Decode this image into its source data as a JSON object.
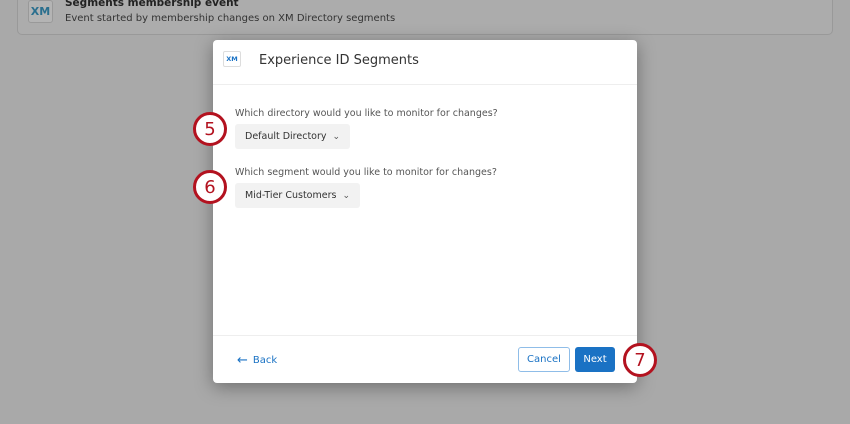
{
  "background": {
    "logo": "XM",
    "title": "Segments membership event",
    "subtitle": "Event started by membership changes on XM Directory segments"
  },
  "modal": {
    "logo": "XM",
    "title": "Experience ID Segments",
    "directory_question": "Which directory would you like to monitor for changes?",
    "directory_value": "Default Directory",
    "segment_question": "Which segment would you like to monitor for changes?",
    "segment_value": "Mid-Tier Customers",
    "back_label": "Back",
    "cancel_label": "Cancel",
    "next_label": "Next"
  },
  "callouts": [
    "5",
    "6",
    "7"
  ]
}
